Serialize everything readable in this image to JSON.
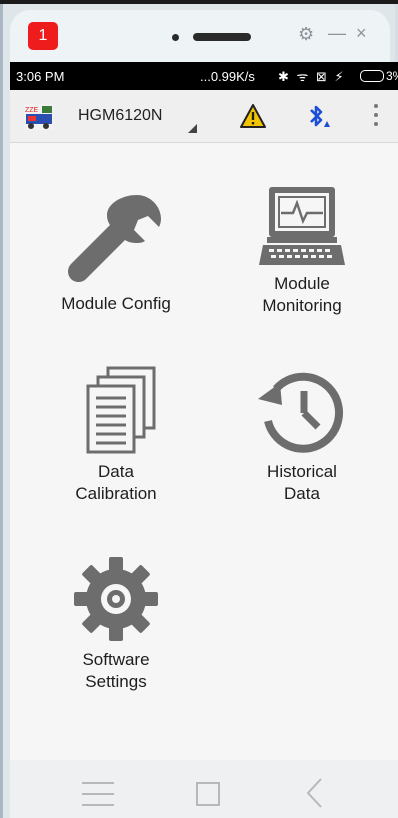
{
  "emulator": {
    "badge": "1",
    "settings_icon": "gear-icon",
    "minimize_label": "—",
    "close_label": "×"
  },
  "status_bar": {
    "time": "3:06 PM",
    "speed": "...0.99K/s",
    "icons": "✱ ᯤ ⊠ ⚡",
    "battery_text": "3%"
  },
  "app_bar": {
    "device_name": "HGM6120N",
    "logo_text": "ZZE",
    "warning_icon": "warning-icon",
    "bluetooth_icon": "bluetooth-icon",
    "overflow_icon": "more-vert-icon"
  },
  "tiles": [
    {
      "label": "Module Config",
      "icon": "wrench-icon"
    },
    {
      "label": "Module\nMonitoring",
      "icon": "monitor-icon"
    },
    {
      "label": "Data\nCalibration",
      "icon": "documents-icon"
    },
    {
      "label": "Historical\nData",
      "icon": "history-icon"
    },
    {
      "label": "Software\nSettings",
      "icon": "gear-icon"
    }
  ],
  "nav": {
    "menu_icon": "menu-icon",
    "home_icon": "home-square-icon",
    "back_icon": "back-chevron-icon"
  },
  "colors": {
    "badge": "#ee1c1c",
    "warning": "#f2c500",
    "bluetooth": "#1a4fd6",
    "icon_gray": "#6d6d6d"
  }
}
